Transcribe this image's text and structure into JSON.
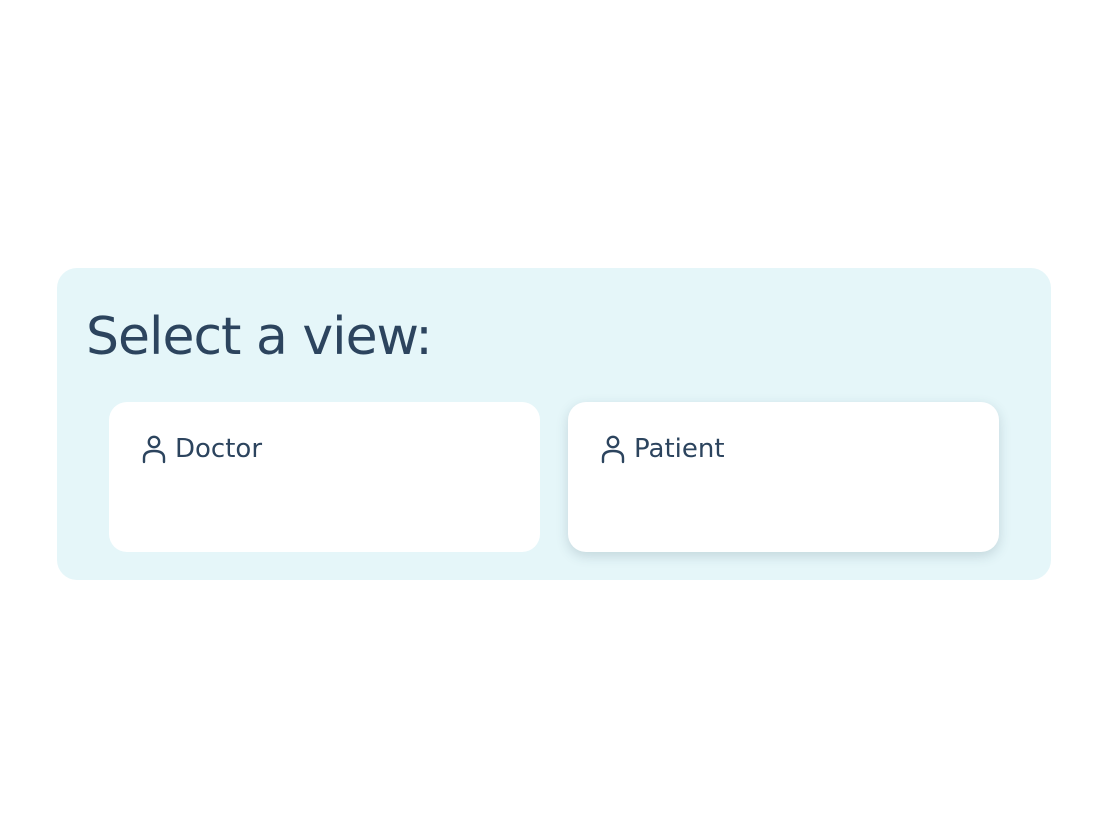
{
  "view_selector": {
    "title": "Select a view:",
    "options": [
      {
        "label": "Doctor",
        "icon": "user-icon"
      },
      {
        "label": "Patient",
        "icon": "user-icon"
      }
    ],
    "colors": {
      "panel_background": "#e5f6f9",
      "text": "#2c445e",
      "card_background": "#ffffff"
    }
  }
}
